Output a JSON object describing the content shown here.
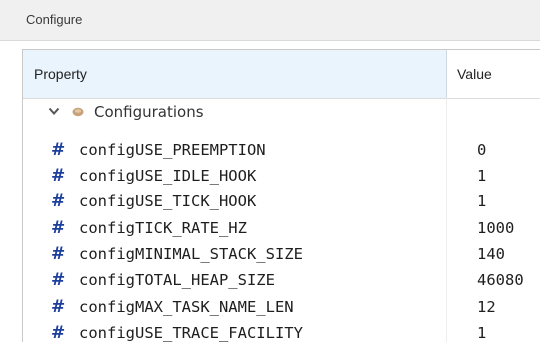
{
  "window": {
    "title": "Configure"
  },
  "table": {
    "headers": {
      "property": "Property",
      "value": "Value"
    },
    "group": {
      "label": "Configurations",
      "expanded": true
    },
    "rows": [
      {
        "name": "configUSE_PREEMPTION",
        "value": "0"
      },
      {
        "name": "configUSE_IDLE_HOOK",
        "value": "1"
      },
      {
        "name": "configUSE_TICK_HOOK",
        "value": "1"
      },
      {
        "name": "configTICK_RATE_HZ",
        "value": "1000"
      },
      {
        "name": "configMINIMAL_STACK_SIZE",
        "value": "140"
      },
      {
        "name": "configTOTAL_HEAP_SIZE",
        "value": "46080"
      },
      {
        "name": "configMAX_TASK_NAME_LEN",
        "value": "12"
      },
      {
        "name": "configUSE_TRACE_FACILITY",
        "value": "1"
      }
    ]
  },
  "icons": {
    "group_toggle": "chevron-down-icon",
    "group": "config-icon",
    "row": "hash-icon"
  },
  "colors": {
    "header_highlight": "#eaf4fd",
    "hash_icon": "#1c3f9e",
    "group_icon": "#c8a27a"
  }
}
